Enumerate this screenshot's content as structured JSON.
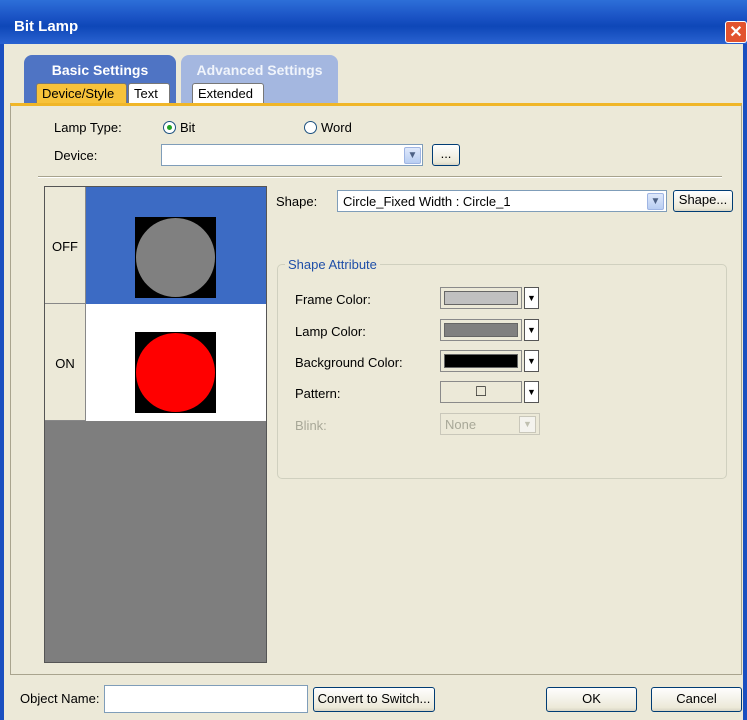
{
  "window": {
    "title": "Bit Lamp",
    "close_glyph": "✕"
  },
  "tabs": {
    "groups": [
      {
        "label": "Basic Settings",
        "subtabs": [
          "Device/Style",
          "Text"
        ]
      },
      {
        "label": "Advanced Settings",
        "subtabs": [
          "Extended"
        ]
      }
    ],
    "active_subtab": "Device/Style"
  },
  "device": {
    "lamp_type_label": "Lamp Type:",
    "options": [
      "Bit",
      "Word"
    ],
    "selected": "Bit",
    "device_label": "Device:",
    "device_value": "",
    "browse_label": "..."
  },
  "preview": {
    "states": [
      {
        "label": "OFF",
        "lamp_color": "#808080",
        "background": "#3c6bc4"
      },
      {
        "label": "ON",
        "lamp_color": "#ff0000",
        "background": "#ffffff"
      }
    ]
  },
  "shape": {
    "label": "Shape:",
    "value": "Circle_Fixed Width : Circle_1",
    "button_label": "Shape..."
  },
  "attributes": {
    "group_label": "Shape Attribute",
    "frame_color_label": "Frame Color:",
    "frame_color": "#c0c0c0",
    "lamp_color_label": "Lamp Color:",
    "lamp_color": "#808080",
    "background_color_label": "Background Color:",
    "background_color": "#000000",
    "pattern_label": "Pattern:",
    "pattern_glyph": "□",
    "blink_label": "Blink:",
    "blink_value": "None"
  },
  "footer": {
    "object_name_label": "Object Name:",
    "object_name_value": "",
    "convert_label": "Convert to Switch...",
    "ok_label": "OK",
    "cancel_label": "Cancel"
  },
  "icons": {
    "dropdown_arrow": "▼",
    "close": "close-icon"
  }
}
